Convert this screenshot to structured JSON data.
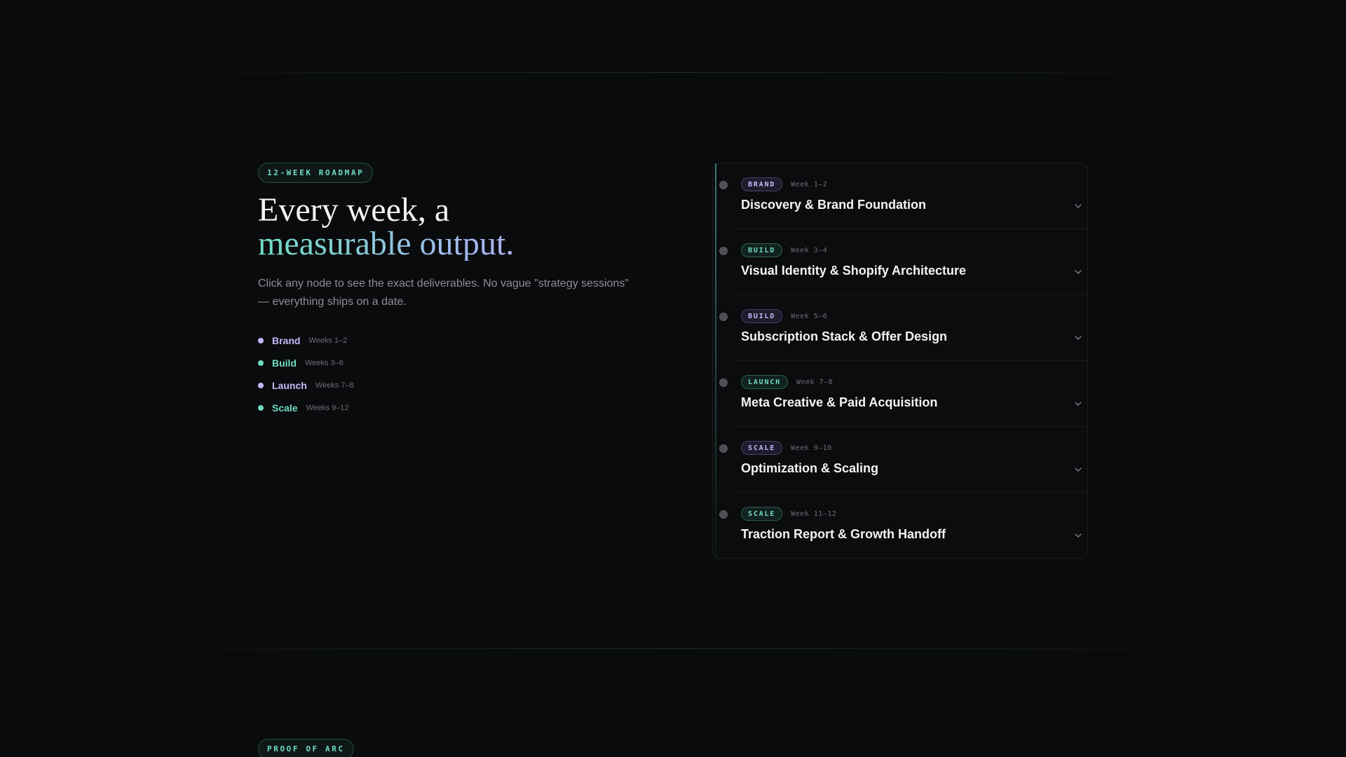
{
  "section": {
    "eyebrow": "12-WEEK ROADMAP",
    "headline_line1": "Every week, a",
    "headline_line2": "measurable output.",
    "subcopy": "Click any node to see the exact deliverables. No vague \"strategy sessions\" — everything ships on a date."
  },
  "legend": [
    {
      "name": "Brand",
      "range": "Weeks 1–2",
      "color": "#c7b6f7"
    },
    {
      "name": "Build",
      "range": "Weeks 3–6",
      "color": "#6fdcc4"
    },
    {
      "name": "Launch",
      "range": "Weeks 7–8",
      "color": "#c7b6f7"
    },
    {
      "name": "Scale",
      "range": "Weeks 9–12",
      "color": "#6fdcc4"
    }
  ],
  "timeline": [
    {
      "tag": "BRAND",
      "week": "Week 1–2",
      "title": "Discovery & Brand Foundation",
      "tone": "purple"
    },
    {
      "tag": "BUILD",
      "week": "Week 3–4",
      "title": "Visual Identity & Shopify Architecture",
      "tone": "teal"
    },
    {
      "tag": "BUILD",
      "week": "Week 5–6",
      "title": "Subscription Stack & Offer Design",
      "tone": "purple"
    },
    {
      "tag": "LAUNCH",
      "week": "Week 7–8",
      "title": "Meta Creative & Paid Acquisition",
      "tone": "teal"
    },
    {
      "tag": "SCALE",
      "week": "Week 9–10",
      "title": "Optimization & Scaling",
      "tone": "purple"
    },
    {
      "tag": "SCALE",
      "week": "Week 11–12",
      "title": "Traction Report & Growth Handoff",
      "tone": "teal"
    }
  ],
  "next_section": {
    "eyebrow": "PROOF OF ARC"
  },
  "colors": {
    "accent_teal": "#6fdcc4",
    "accent_purple": "#c7b6f7",
    "background": "#0a0b0d"
  },
  "icons": {
    "expand": "chevron-down-icon",
    "node": "timeline-node-icon"
  }
}
